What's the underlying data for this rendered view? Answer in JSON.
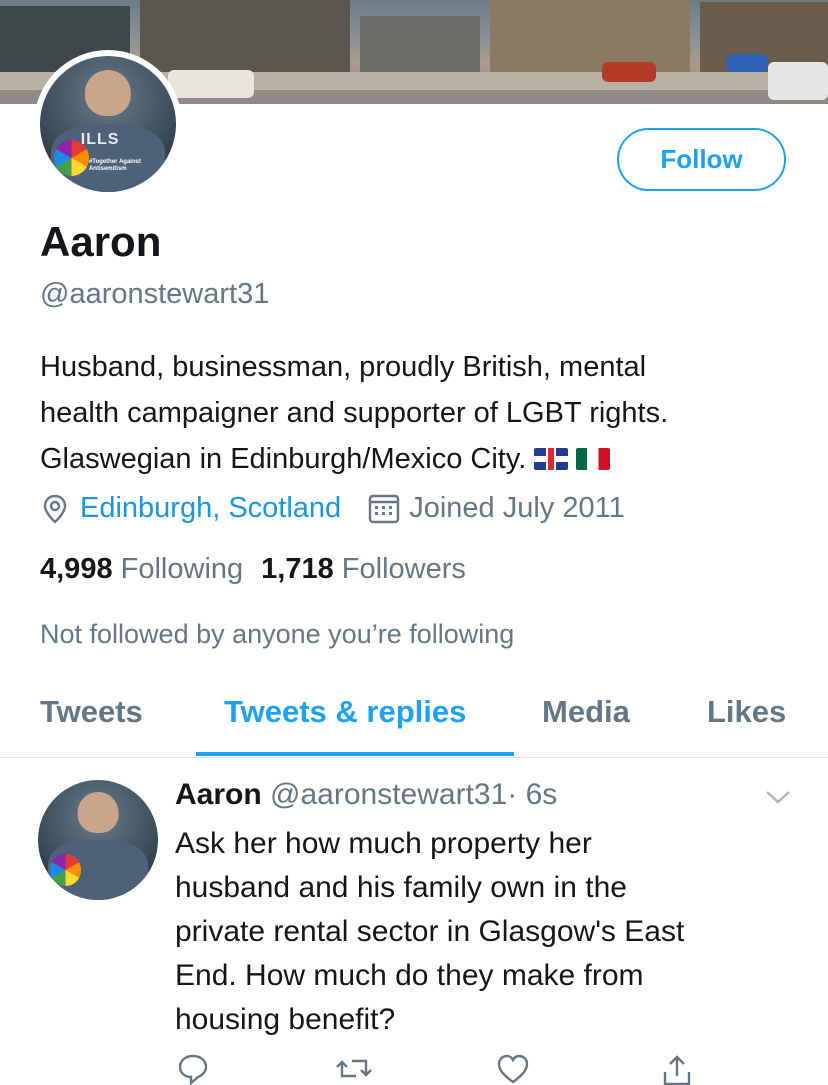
{
  "profile": {
    "name": "Aaron",
    "handle": "@aaronstewart31",
    "follow_label": "Follow",
    "bio_lines": [
      "Husband, businessman, proudly British, mental",
      "health campaigner and supporter of LGBT rights.",
      "Glaswegian in Edinburgh/Mexico City."
    ],
    "location": "Edinburgh, Scotland",
    "joined": "Joined July 2011",
    "following_count": "4,998",
    "following_label": "Following",
    "followers_count": "1,718",
    "followers_label": "Followers",
    "not_followed_text": "Not followed by anyone you’re following",
    "avatar_shirt_text": "ILLS",
    "avatar_caption": "#Together Against Antisemitism"
  },
  "tabs": [
    {
      "label": "Tweets",
      "active": false
    },
    {
      "label": "Tweets & replies",
      "active": true
    },
    {
      "label": "Media",
      "active": false
    },
    {
      "label": "Likes",
      "active": false
    }
  ],
  "tweet": {
    "name": "Aaron",
    "handle": "@aaronstewart31",
    "time": "· 6s",
    "text_lines": [
      "Ask her how much property her",
      "husband and his family own in the",
      "private rental sector in Glasgow's East",
      "End. How much do they make from",
      "housing benefit?"
    ]
  },
  "colors": {
    "accent": "#1da1f2",
    "secondary_text": "#657786",
    "primary_text": "#14171a"
  }
}
